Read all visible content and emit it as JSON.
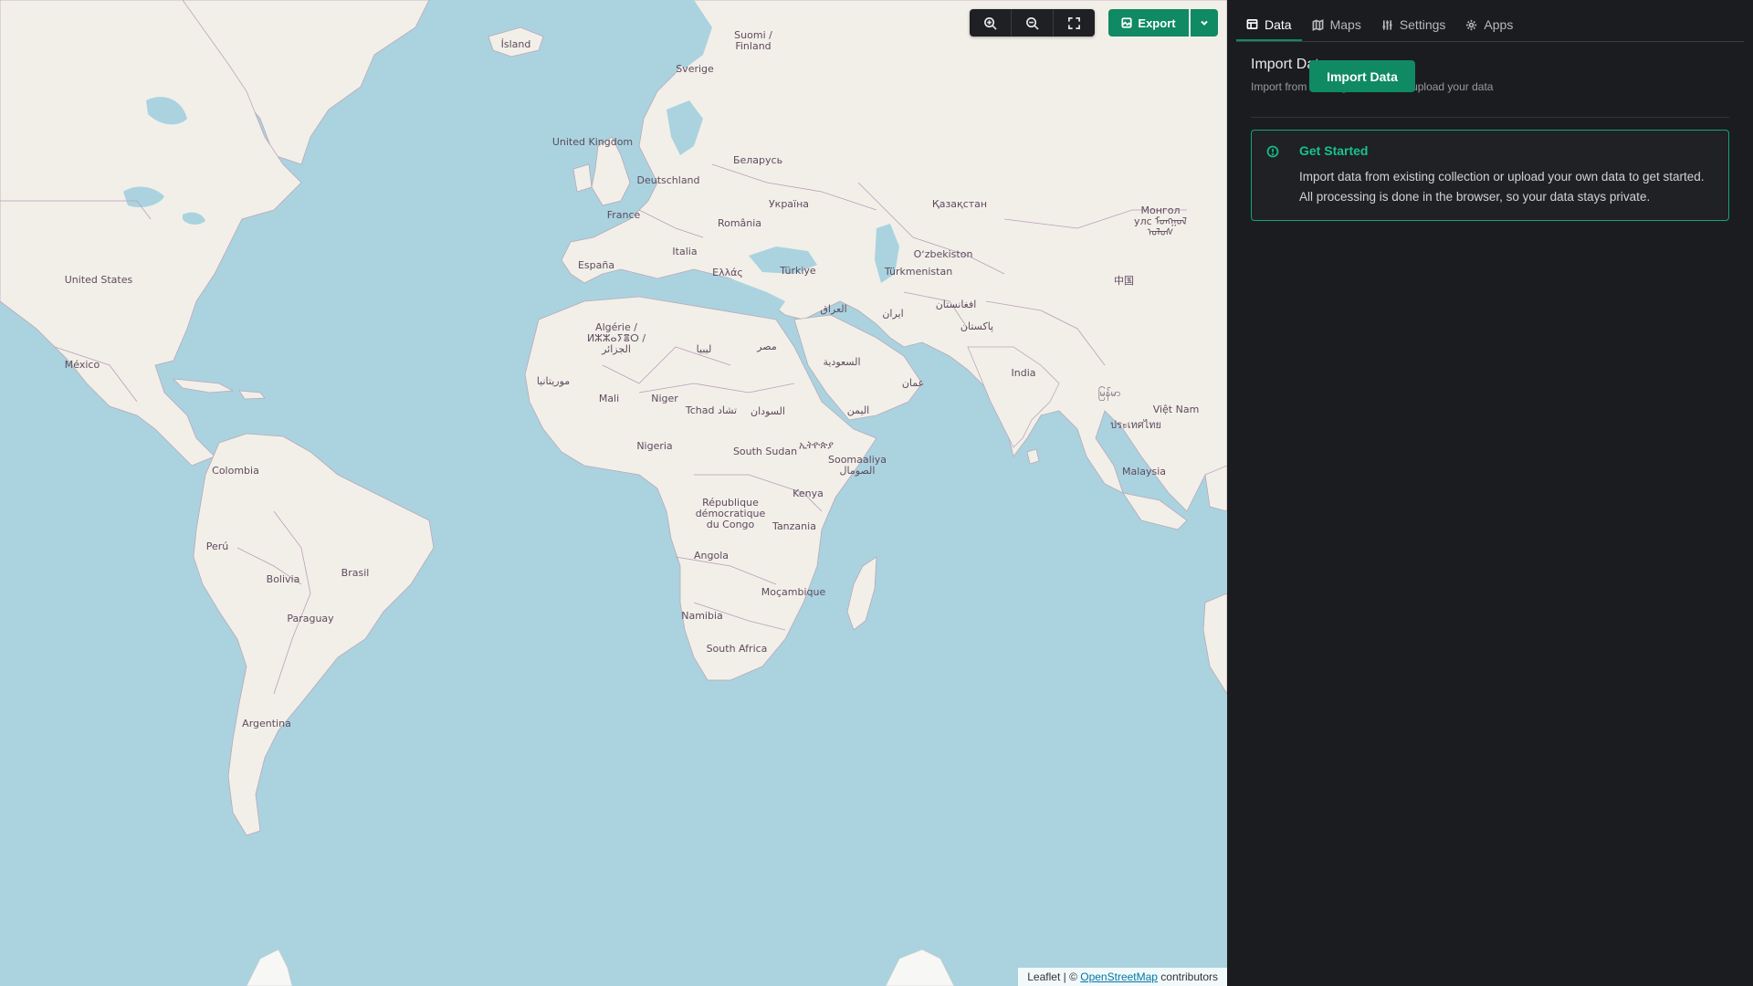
{
  "map": {
    "labels": [
      {
        "id": "island",
        "text": "Ísland"
      },
      {
        "id": "finland",
        "text": "Suomi /\nFinland"
      },
      {
        "id": "sverige",
        "text": "Sverige"
      },
      {
        "id": "uk",
        "text": "United Kingdom"
      },
      {
        "id": "belarus",
        "text": "Беларусь"
      },
      {
        "id": "deutschland",
        "text": "Deutschland"
      },
      {
        "id": "ukraina",
        "text": "Україна"
      },
      {
        "id": "kazakhstan",
        "text": "Қазақстан"
      },
      {
        "id": "mongolia",
        "text": "Монгол\nулс ᠮᠣᠩᠭᠣᠯ\nᠤᠯᠤᠰ"
      },
      {
        "id": "france",
        "text": "France"
      },
      {
        "id": "romania",
        "text": "România"
      },
      {
        "id": "usa",
        "text": "United States"
      },
      {
        "id": "italia",
        "text": "Italia"
      },
      {
        "id": "uzbekistan",
        "text": "Oʻzbekiston"
      },
      {
        "id": "espana",
        "text": "España"
      },
      {
        "id": "ellas",
        "text": "Ελλάς"
      },
      {
        "id": "turkiye",
        "text": "Türkiye"
      },
      {
        "id": "turkmenistan",
        "text": "Türkmenistan"
      },
      {
        "id": "china",
        "text": "中国"
      },
      {
        "id": "afghanistan",
        "text": "افغانستان"
      },
      {
        "id": "iraq",
        "text": "العراق"
      },
      {
        "id": "iran",
        "text": "ایران"
      },
      {
        "id": "pakistan",
        "text": "پاکستان"
      },
      {
        "id": "algerie",
        "text": "Algérie /\nⵍⵣⵣⴰⵢⴻⵔ /\nالجزائر"
      },
      {
        "id": "mexico",
        "text": "México"
      },
      {
        "id": "libya",
        "text": "ليبيا"
      },
      {
        "id": "egypt",
        "text": "مصر"
      },
      {
        "id": "saudi",
        "text": "السعودية"
      },
      {
        "id": "mauritania",
        "text": "موريتانيا"
      },
      {
        "id": "india",
        "text": "India"
      },
      {
        "id": "oman",
        "text": "عمان"
      },
      {
        "id": "mali",
        "text": "Mali"
      },
      {
        "id": "niger",
        "text": "Niger"
      },
      {
        "id": "tchad",
        "text": "Tchad تشاد"
      },
      {
        "id": "sudan",
        "text": "السودان"
      },
      {
        "id": "yemen",
        "text": "اليمن"
      },
      {
        "id": "myanmar",
        "text": "မြန်မာ"
      },
      {
        "id": "vietnam",
        "text": "Việt Nam"
      },
      {
        "id": "thailand",
        "text": "ประเทศไทย"
      },
      {
        "id": "nigeria",
        "text": "Nigeria"
      },
      {
        "id": "ethiopia",
        "text": "ኢትዮጵያ"
      },
      {
        "id": "southsudan",
        "text": "South Sudan"
      },
      {
        "id": "somalia",
        "text": "Soomaaliya\nالصومال"
      },
      {
        "id": "colombia",
        "text": "Colombia"
      },
      {
        "id": "malaysia",
        "text": "Malaysia"
      },
      {
        "id": "kenya",
        "text": "Kenya"
      },
      {
        "id": "drc",
        "text": "République\ndémocratique\ndu Congo"
      },
      {
        "id": "tanzania",
        "text": "Tanzania"
      },
      {
        "id": "peru",
        "text": "Perú"
      },
      {
        "id": "brasil",
        "text": "Brasil"
      },
      {
        "id": "bolivia",
        "text": "Bolivia"
      },
      {
        "id": "angola",
        "text": "Angola"
      },
      {
        "id": "mocambique",
        "text": "Moçambique"
      },
      {
        "id": "namibia",
        "text": "Namibia"
      },
      {
        "id": "paraguay",
        "text": "Paraguay"
      },
      {
        "id": "southafrica",
        "text": "South Africa"
      },
      {
        "id": "argentina",
        "text": "Argentina"
      }
    ],
    "attribution": {
      "prefix": "Leaflet | © ",
      "link": "OpenStreetMap",
      "suffix": " contributors"
    }
  },
  "toolbar": {
    "zoom_in_icon": "zoom-in-icon",
    "zoom_out_icon": "zoom-out-icon",
    "fullscreen_icon": "fullscreen-icon",
    "export_label": "Export",
    "accent": "#0f8a63"
  },
  "panel": {
    "tabs": [
      {
        "label": "Data",
        "icon": "table-icon",
        "active": true
      },
      {
        "label": "Maps",
        "icon": "map-icon",
        "active": false
      },
      {
        "label": "Settings",
        "icon": "sliders-icon",
        "active": false
      },
      {
        "label": "Apps",
        "icon": "gear-icon",
        "active": false
      }
    ],
    "title": "Import Data",
    "subtitle": "Import from existing collection or upload your data",
    "import_button": "Import Data",
    "alert": {
      "title": "Get Started",
      "text": "Import data from existing collection or upload your own data to get started. All processing is done in the browser, so your data stays private.",
      "color": "#18c28b"
    }
  }
}
